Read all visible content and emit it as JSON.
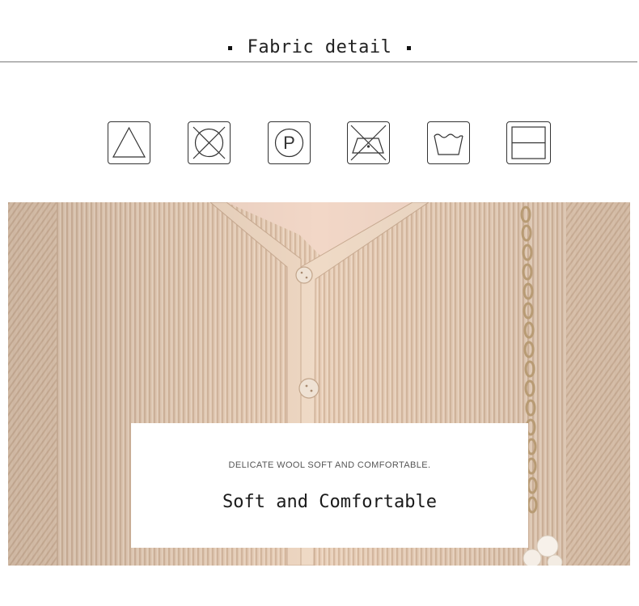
{
  "header": {
    "title": "Fabric detail"
  },
  "care_icons": [
    {
      "name": "bleach-triangle-icon"
    },
    {
      "name": "do-not-tumble-dry-icon"
    },
    {
      "name": "dry-clean-p-icon",
      "symbol": "P"
    },
    {
      "name": "do-not-iron-icon"
    },
    {
      "name": "hand-wash-icon"
    },
    {
      "name": "dry-flat-icon"
    }
  ],
  "product_card": {
    "subtitle": "DELICATE WOOL SOFT AND COMFORTABLE.",
    "title": "Soft and Comfortable"
  },
  "colors": {
    "fabric": "#e9d2bd",
    "accent": "#111111"
  }
}
